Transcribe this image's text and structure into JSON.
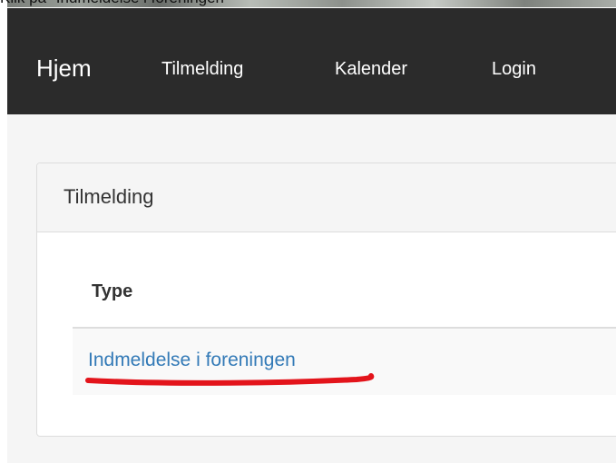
{
  "caption": {
    "prefix": "Klik på \"Indmeldelse i foreningen\""
  },
  "navbar": {
    "brand": "Hjem",
    "links": [
      "Tilmelding",
      "Kalender",
      "Login"
    ]
  },
  "panel": {
    "title": "Tilmelding",
    "table": {
      "columns": [
        "Type"
      ],
      "rows": [
        {
          "type": "Indmeldelse i foreningen"
        }
      ]
    }
  },
  "colors": {
    "navbar": "#2b2b2b",
    "link": "#337ab7",
    "highlight_mark": "#e3141b"
  }
}
